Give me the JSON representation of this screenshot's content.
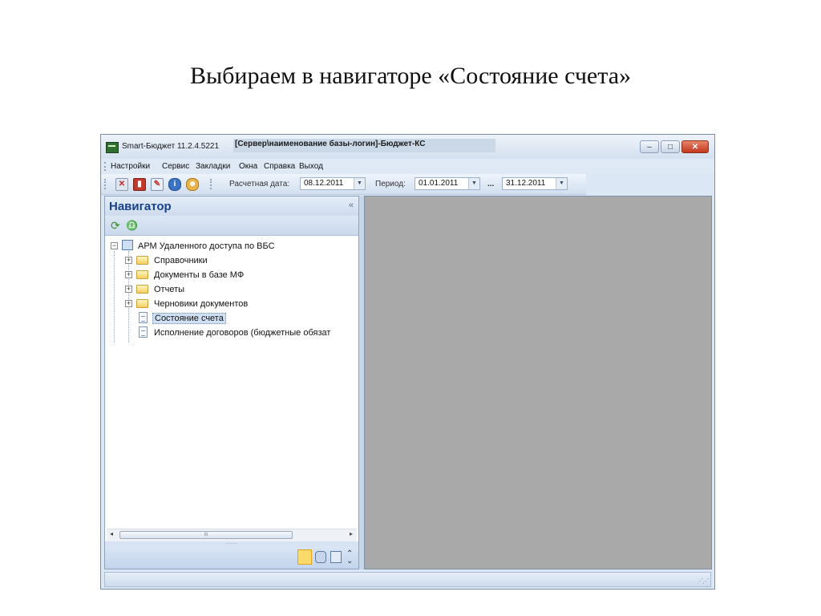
{
  "slide": {
    "title": "Выбираем в навигаторе «Состояние счета»"
  },
  "window": {
    "title": "Smart-Бюджет 11.2.4.5221",
    "title_extra": "[Сервер\\наименование базы-логин]-Бюджет-КС",
    "controls": {
      "minimize": "–",
      "maximize": "□",
      "close": "✕"
    }
  },
  "menu": {
    "items": [
      "Настройки",
      "Сервис",
      "Закладки",
      "Окна",
      "Справка",
      "Выход"
    ]
  },
  "toolbar": {
    "calc_date_label": "Расчетная дата:",
    "calc_date_value": "08.12.2011",
    "period_label": "Период:",
    "period_from": "01.01.2011",
    "period_sep": "...",
    "period_to": "31.12.2011",
    "icons": [
      "delete-doc-icon",
      "book-icon",
      "edit-icon",
      "info-icon",
      "users-icon"
    ]
  },
  "navigator": {
    "title": "Навигатор",
    "collapse": "«",
    "tree": {
      "root": "АРМ Удаленного доступа по ВБС",
      "items": [
        {
          "label": "Справочники",
          "type": "folder",
          "expandable": true
        },
        {
          "label": "Документы в базе МФ",
          "type": "folder",
          "expandable": true
        },
        {
          "label": "Отчеты",
          "type": "folder",
          "expandable": true
        },
        {
          "label": "Черновики документов",
          "type": "folder",
          "expandable": true
        },
        {
          "label": "Состояние счета",
          "type": "document",
          "selected": true
        },
        {
          "label": "Исполнение договоров (бюджетные обязат",
          "type": "document"
        }
      ]
    },
    "scroll": {
      "left": "◂",
      "right": "▸",
      "thumb": "III"
    },
    "splitter": "........."
  },
  "colors": {
    "accent": "#15428b",
    "content_bg": "#a9a9a9",
    "selection": "#cfe0f5"
  }
}
